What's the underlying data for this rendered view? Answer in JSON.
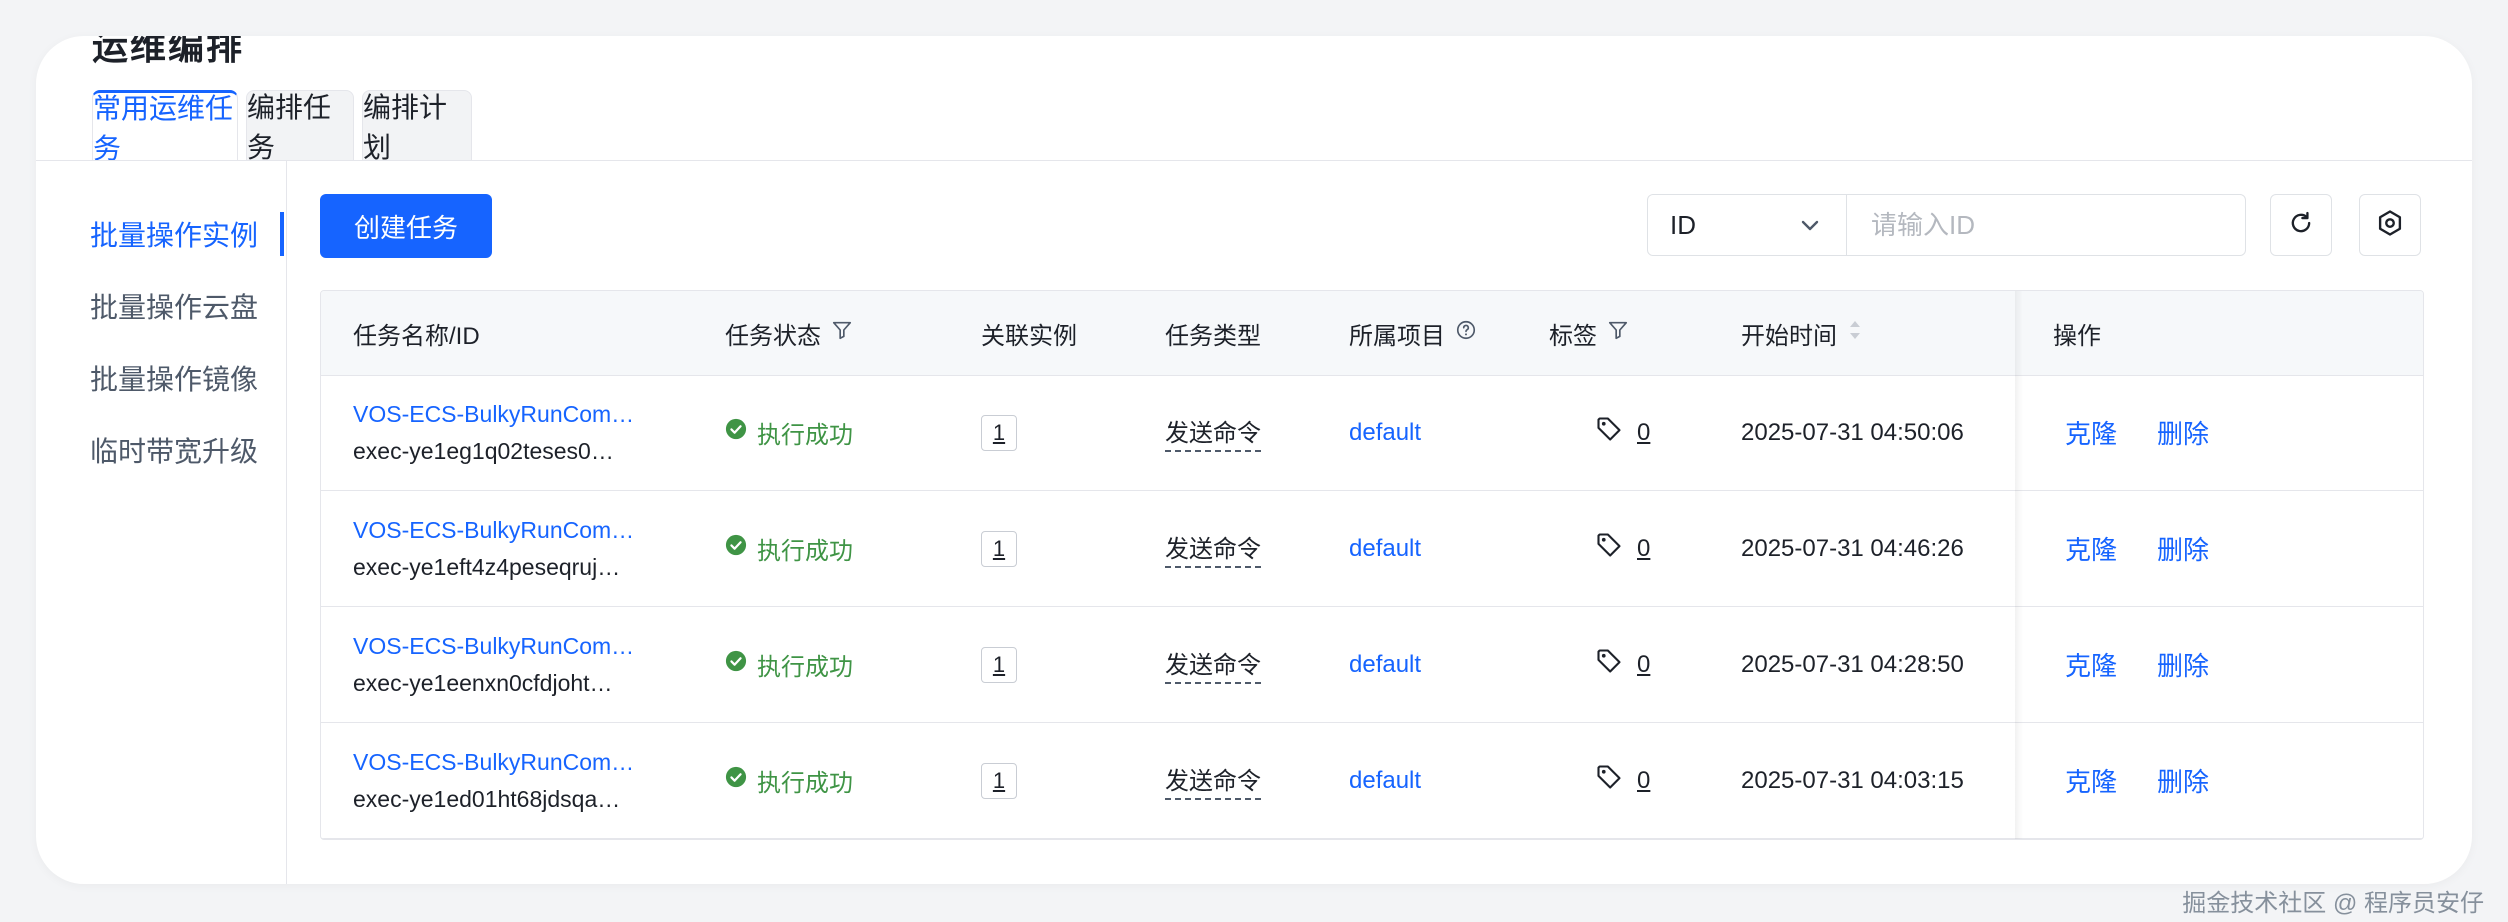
{
  "page": {
    "clipped_title": "运维编排"
  },
  "tabs": [
    {
      "label": "常用运维任务",
      "active": true
    },
    {
      "label": "编排任务",
      "active": false
    },
    {
      "label": "编排计划",
      "active": false
    }
  ],
  "sidebar": {
    "items": [
      {
        "label": "批量操作实例",
        "active": true
      },
      {
        "label": "批量操作云盘",
        "active": false
      },
      {
        "label": "批量操作镜像",
        "active": false
      },
      {
        "label": "临时带宽升级",
        "active": false
      }
    ]
  },
  "toolbar": {
    "create_label": "创建任务",
    "search_field_value": "ID",
    "search_placeholder": "请输入ID",
    "refresh_icon": "refresh-icon",
    "settings_icon": "gear-icon"
  },
  "table": {
    "columns": {
      "name": "任务名称/ID",
      "status": "任务状态",
      "instance": "关联实例",
      "type": "任务类型",
      "project": "所属项目",
      "tags": "标签",
      "start": "开始时间",
      "ops": "操作"
    },
    "rows": [
      {
        "name": "VOS-ECS-BulkyRunCom…",
        "id": "exec-ye1eg1q02teses0…",
        "status": "执行成功",
        "instances": "1",
        "type": "发送命令",
        "project": "default",
        "tags": "0",
        "start": "2025-07-31 04:50:06",
        "clone": "克隆",
        "delete": "删除"
      },
      {
        "name": "VOS-ECS-BulkyRunCom…",
        "id": "exec-ye1eft4z4peseqruj…",
        "status": "执行成功",
        "instances": "1",
        "type": "发送命令",
        "project": "default",
        "tags": "0",
        "start": "2025-07-31 04:46:26",
        "clone": "克隆",
        "delete": "删除"
      },
      {
        "name": "VOS-ECS-BulkyRunCom…",
        "id": "exec-ye1eenxn0cfdjoht…",
        "status": "执行成功",
        "instances": "1",
        "type": "发送命令",
        "project": "default",
        "tags": "0",
        "start": "2025-07-31 04:28:50",
        "clone": "克隆",
        "delete": "删除"
      },
      {
        "name": "VOS-ECS-BulkyRunCom…",
        "id": "exec-ye1ed01ht68jdsqa…",
        "status": "执行成功",
        "instances": "1",
        "type": "发送命令",
        "project": "default",
        "tags": "0",
        "start": "2025-07-31 04:03:15",
        "clone": "克隆",
        "delete": "删除"
      }
    ]
  },
  "watermark": "掘金技术社区 @ 程序员安仔",
  "colors": {
    "accent": "#1664ff",
    "success": "#3f9445"
  }
}
